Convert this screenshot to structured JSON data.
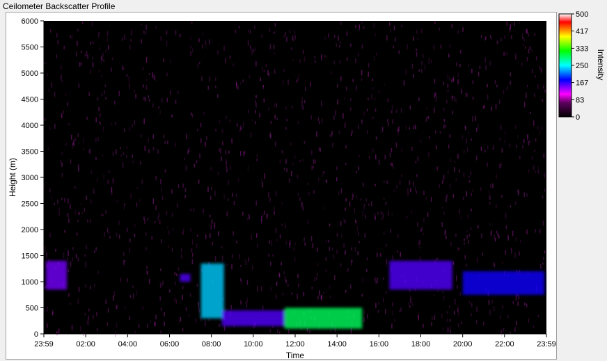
{
  "window": {
    "title": "Ceilometer Backscatter Profile"
  },
  "chart_data": {
    "type": "heatmap",
    "title": "Ceilometer Backscatter Profile",
    "xlabel": "Time",
    "ylabel": "Height (m)",
    "x_ticks": [
      "23:59",
      "02:00",
      "04:00",
      "06:00",
      "08:00",
      "10:00",
      "12:00",
      "14:00",
      "16:00",
      "18:00",
      "20:00",
      "22:00",
      "23:59"
    ],
    "y_ticks": [
      0,
      500,
      1000,
      1500,
      2000,
      2500,
      3000,
      3500,
      4000,
      4500,
      5000,
      5500,
      6000
    ],
    "ylim": [
      0,
      6000
    ],
    "xlim_hours": [
      0,
      24
    ],
    "colorbar": {
      "label": "Intensity",
      "ticks": [
        0,
        83,
        167,
        250,
        333,
        417,
        500
      ],
      "range": [
        0,
        500
      ],
      "colors": [
        "#000000",
        "#ff00ff",
        "#0000ff",
        "#00ffff",
        "#00ff00",
        "#ffff00",
        "#ff0000",
        "#ffffff"
      ]
    },
    "layers": [
      {
        "hour_start": 0.1,
        "hour_end": 1.1,
        "height_low": 850,
        "height_high": 1400,
        "intensity": 110
      },
      {
        "hour_start": 6.5,
        "hour_end": 7.0,
        "height_low": 1000,
        "height_high": 1150,
        "intensity": 120
      },
      {
        "hour_start": 7.5,
        "hour_end": 8.6,
        "height_low": 300,
        "height_high": 1350,
        "intensity": 200
      },
      {
        "hour_start": 8.5,
        "hour_end": 11.5,
        "height_low": 150,
        "height_high": 450,
        "intensity": 120
      },
      {
        "hour_start": 11.5,
        "hour_end": 15.2,
        "height_low": 100,
        "height_high": 500,
        "intensity": 260
      },
      {
        "hour_start": 16.5,
        "hour_end": 19.5,
        "height_low": 850,
        "height_high": 1400,
        "intensity": 120
      },
      {
        "hour_start": 20.0,
        "hour_end": 23.9,
        "height_low": 750,
        "height_high": 1200,
        "intensity": 140
      }
    ]
  }
}
